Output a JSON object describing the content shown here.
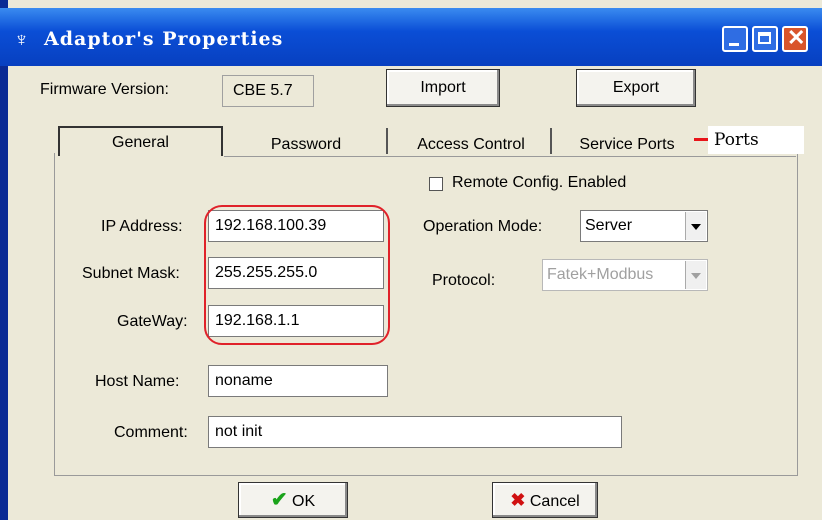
{
  "window": {
    "title": "Adaptor's Properties",
    "icon": "adaptor-app-icon"
  },
  "firmware": {
    "label": "Firmware Version:",
    "value": "CBE 5.7"
  },
  "buttons": {
    "import": "Import",
    "export": "Export",
    "ok": "OK",
    "cancel": "Cancel"
  },
  "tabs": [
    {
      "label": "General",
      "active": true
    },
    {
      "label": "Password",
      "active": false
    },
    {
      "label": "Access Control",
      "active": false
    },
    {
      "label": "Service Ports",
      "active": false
    }
  ],
  "annotation": {
    "ports_label": "Ports",
    "arrow_color": "#e8141a"
  },
  "general": {
    "remote_config_label": "Remote Config. Enabled",
    "remote_config_checked": false,
    "ip_label": "IP Address:",
    "ip_value": "192.168.100.39",
    "subnet_label": "Subnet Mask:",
    "subnet_value": "255.255.255.0",
    "gateway_label": "GateWay:",
    "gateway_value": "192.168.1.1",
    "host_label": "Host Name:",
    "host_value": "noname",
    "comment_label": "Comment:",
    "comment_value": "not init",
    "operation_mode_label": "Operation Mode:",
    "operation_mode_value": "Server",
    "protocol_label": "Protocol:",
    "protocol_value": "Fatek+Modbus"
  },
  "colors": {
    "titlebar": "#0a4ed6",
    "highlight": "#e0222a",
    "dialog_bg": "#ece9d8"
  }
}
